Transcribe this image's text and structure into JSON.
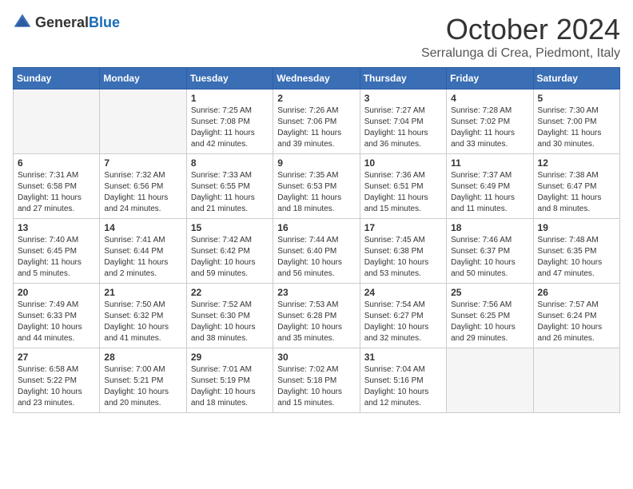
{
  "header": {
    "logo_general": "General",
    "logo_blue": "Blue",
    "month_title": "October 2024",
    "location": "Serralunga di Crea, Piedmont, Italy"
  },
  "days_of_week": [
    "Sunday",
    "Monday",
    "Tuesday",
    "Wednesday",
    "Thursday",
    "Friday",
    "Saturday"
  ],
  "weeks": [
    [
      {
        "day": "",
        "empty": true
      },
      {
        "day": "",
        "empty": true
      },
      {
        "day": "1",
        "sunrise": "Sunrise: 7:25 AM",
        "sunset": "Sunset: 7:08 PM",
        "daylight": "Daylight: 11 hours and 42 minutes."
      },
      {
        "day": "2",
        "sunrise": "Sunrise: 7:26 AM",
        "sunset": "Sunset: 7:06 PM",
        "daylight": "Daylight: 11 hours and 39 minutes."
      },
      {
        "day": "3",
        "sunrise": "Sunrise: 7:27 AM",
        "sunset": "Sunset: 7:04 PM",
        "daylight": "Daylight: 11 hours and 36 minutes."
      },
      {
        "day": "4",
        "sunrise": "Sunrise: 7:28 AM",
        "sunset": "Sunset: 7:02 PM",
        "daylight": "Daylight: 11 hours and 33 minutes."
      },
      {
        "day": "5",
        "sunrise": "Sunrise: 7:30 AM",
        "sunset": "Sunset: 7:00 PM",
        "daylight": "Daylight: 11 hours and 30 minutes."
      }
    ],
    [
      {
        "day": "6",
        "sunrise": "Sunrise: 7:31 AM",
        "sunset": "Sunset: 6:58 PM",
        "daylight": "Daylight: 11 hours and 27 minutes."
      },
      {
        "day": "7",
        "sunrise": "Sunrise: 7:32 AM",
        "sunset": "Sunset: 6:56 PM",
        "daylight": "Daylight: 11 hours and 24 minutes."
      },
      {
        "day": "8",
        "sunrise": "Sunrise: 7:33 AM",
        "sunset": "Sunset: 6:55 PM",
        "daylight": "Daylight: 11 hours and 21 minutes."
      },
      {
        "day": "9",
        "sunrise": "Sunrise: 7:35 AM",
        "sunset": "Sunset: 6:53 PM",
        "daylight": "Daylight: 11 hours and 18 minutes."
      },
      {
        "day": "10",
        "sunrise": "Sunrise: 7:36 AM",
        "sunset": "Sunset: 6:51 PM",
        "daylight": "Daylight: 11 hours and 15 minutes."
      },
      {
        "day": "11",
        "sunrise": "Sunrise: 7:37 AM",
        "sunset": "Sunset: 6:49 PM",
        "daylight": "Daylight: 11 hours and 11 minutes."
      },
      {
        "day": "12",
        "sunrise": "Sunrise: 7:38 AM",
        "sunset": "Sunset: 6:47 PM",
        "daylight": "Daylight: 11 hours and 8 minutes."
      }
    ],
    [
      {
        "day": "13",
        "sunrise": "Sunrise: 7:40 AM",
        "sunset": "Sunset: 6:45 PM",
        "daylight": "Daylight: 11 hours and 5 minutes."
      },
      {
        "day": "14",
        "sunrise": "Sunrise: 7:41 AM",
        "sunset": "Sunset: 6:44 PM",
        "daylight": "Daylight: 11 hours and 2 minutes."
      },
      {
        "day": "15",
        "sunrise": "Sunrise: 7:42 AM",
        "sunset": "Sunset: 6:42 PM",
        "daylight": "Daylight: 10 hours and 59 minutes."
      },
      {
        "day": "16",
        "sunrise": "Sunrise: 7:44 AM",
        "sunset": "Sunset: 6:40 PM",
        "daylight": "Daylight: 10 hours and 56 minutes."
      },
      {
        "day": "17",
        "sunrise": "Sunrise: 7:45 AM",
        "sunset": "Sunset: 6:38 PM",
        "daylight": "Daylight: 10 hours and 53 minutes."
      },
      {
        "day": "18",
        "sunrise": "Sunrise: 7:46 AM",
        "sunset": "Sunset: 6:37 PM",
        "daylight": "Daylight: 10 hours and 50 minutes."
      },
      {
        "day": "19",
        "sunrise": "Sunrise: 7:48 AM",
        "sunset": "Sunset: 6:35 PM",
        "daylight": "Daylight: 10 hours and 47 minutes."
      }
    ],
    [
      {
        "day": "20",
        "sunrise": "Sunrise: 7:49 AM",
        "sunset": "Sunset: 6:33 PM",
        "daylight": "Daylight: 10 hours and 44 minutes."
      },
      {
        "day": "21",
        "sunrise": "Sunrise: 7:50 AM",
        "sunset": "Sunset: 6:32 PM",
        "daylight": "Daylight: 10 hours and 41 minutes."
      },
      {
        "day": "22",
        "sunrise": "Sunrise: 7:52 AM",
        "sunset": "Sunset: 6:30 PM",
        "daylight": "Daylight: 10 hours and 38 minutes."
      },
      {
        "day": "23",
        "sunrise": "Sunrise: 7:53 AM",
        "sunset": "Sunset: 6:28 PM",
        "daylight": "Daylight: 10 hours and 35 minutes."
      },
      {
        "day": "24",
        "sunrise": "Sunrise: 7:54 AM",
        "sunset": "Sunset: 6:27 PM",
        "daylight": "Daylight: 10 hours and 32 minutes."
      },
      {
        "day": "25",
        "sunrise": "Sunrise: 7:56 AM",
        "sunset": "Sunset: 6:25 PM",
        "daylight": "Daylight: 10 hours and 29 minutes."
      },
      {
        "day": "26",
        "sunrise": "Sunrise: 7:57 AM",
        "sunset": "Sunset: 6:24 PM",
        "daylight": "Daylight: 10 hours and 26 minutes."
      }
    ],
    [
      {
        "day": "27",
        "sunrise": "Sunrise: 6:58 AM",
        "sunset": "Sunset: 5:22 PM",
        "daylight": "Daylight: 10 hours and 23 minutes."
      },
      {
        "day": "28",
        "sunrise": "Sunrise: 7:00 AM",
        "sunset": "Sunset: 5:21 PM",
        "daylight": "Daylight: 10 hours and 20 minutes."
      },
      {
        "day": "29",
        "sunrise": "Sunrise: 7:01 AM",
        "sunset": "Sunset: 5:19 PM",
        "daylight": "Daylight: 10 hours and 18 minutes."
      },
      {
        "day": "30",
        "sunrise": "Sunrise: 7:02 AM",
        "sunset": "Sunset: 5:18 PM",
        "daylight": "Daylight: 10 hours and 15 minutes."
      },
      {
        "day": "31",
        "sunrise": "Sunrise: 7:04 AM",
        "sunset": "Sunset: 5:16 PM",
        "daylight": "Daylight: 10 hours and 12 minutes."
      },
      {
        "day": "",
        "empty": true
      },
      {
        "day": "",
        "empty": true
      }
    ]
  ]
}
